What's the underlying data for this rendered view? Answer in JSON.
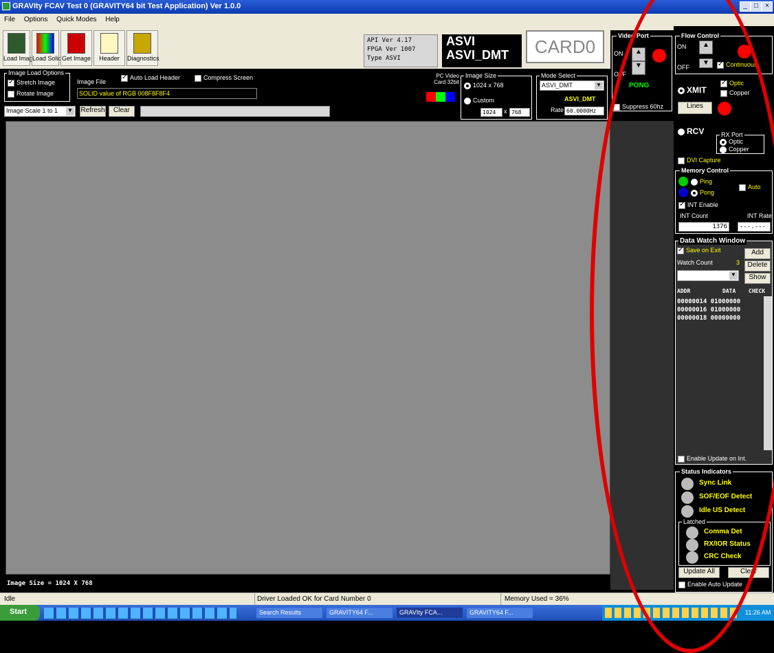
{
  "window": {
    "title": "GRAVIty FCAV Test 0 (GRAVITY64 bit Test Application) Ver 1.0.0"
  },
  "menu": [
    "File",
    "Options",
    "Quick Modes",
    "Help"
  ],
  "toolbar": {
    "buttons": [
      {
        "label": "Load Image",
        "icon": "image-icon"
      },
      {
        "label": "Load Solid",
        "icon": "rgb-icon"
      },
      {
        "label": "Get Image",
        "icon": "get-image-icon"
      },
      {
        "label": "Header",
        "icon": "header-icon"
      },
      {
        "label": "Diagnostics",
        "icon": "diagnostics-icon"
      }
    ]
  },
  "version_info": {
    "api": "API Ver  4.17",
    "fpga": "FPGA Ver  1007",
    "type": "Type  ASVI"
  },
  "mode_display": {
    "line1": "ASVI",
    "line2": "ASVI_DMT"
  },
  "card": "CARD0",
  "image_load": {
    "group_title": "Image Load Options",
    "stretch": "Stretch Image",
    "rotate": "Rotate Image",
    "file_label": "Image File",
    "auto_load_header": "Auto Load Header",
    "compress_screen": "Compress Screen",
    "file_value": "SOLID value of RGB 008F8F8F4",
    "scale": "Image Scale 1 to 1",
    "refresh": "Refresh",
    "clear": "Clear"
  },
  "pc_video": {
    "line1": "PC Video",
    "line2": "Card 32bit"
  },
  "image_size": {
    "title": "Image Size",
    "opt1": "1024 x 768",
    "opt2": "Custom",
    "w": "1024",
    "x": "x",
    "h": "768"
  },
  "mode_select": {
    "title": "Mode Select",
    "value": "ASVI_DMT",
    "name": "ASVI_DMT",
    "rate_label": "Rate",
    "rate": "60.0000Hz"
  },
  "video_port": {
    "title": "Video Port",
    "on": "ON",
    "off": "OFF",
    "state": "PONG",
    "suppress": "Suppress 60hz"
  },
  "flow_control": {
    "title": "Flow Control",
    "on": "ON",
    "off": "OFF",
    "continuous": "Continuous"
  },
  "xmit": {
    "label": "XMIT",
    "optic": "Optic",
    "copper": "Copper",
    "lines": "Lines"
  },
  "rcv": {
    "label": "RCV",
    "port_title": "RX Port",
    "optic": "Optic",
    "copper": "Copper",
    "dvi": "DVI Capture"
  },
  "memory": {
    "title": "Memory Control",
    "ping": "Ping",
    "pong": "Pong",
    "auto": "Auto",
    "int_enable": "INT Enable",
    "int_count_label": "INT Count",
    "int_rate_label": "INT Rate",
    "int_count": "1376",
    "int_rate": "---.---"
  },
  "watch": {
    "title": "Data Watch Window",
    "save_on_exit": "Save on Exit",
    "add": "Add",
    "watch_count": "Watch Count",
    "count": "3",
    "delete": "Delete",
    "show": "Show",
    "col_addr": "ADDR",
    "col_data": "DATA",
    "col_chk": "CHECK",
    "rows": [
      "00000014  01000000",
      "00000016  01000000",
      "00000018  00000000"
    ],
    "enable_update": "Enable Update on Int."
  },
  "status": {
    "title": "Status Indicators",
    "sync": "Sync Link",
    "sof": "SOF/EOF Detect",
    "idle": "Idle US Detect",
    "latched": "Latched",
    "comma": "Comma Det",
    "rx": "RX/IOR Status",
    "crc": "CRC Check",
    "update_all": "Update All",
    "clear": "Clear",
    "auto_update": "Enable Auto Update"
  },
  "image_size_readout": "Image Size = 1024 X 768",
  "statusbar": {
    "left": "Idle",
    "middle": "Driver Loaded OK for Card Number 0",
    "right": "Memory Used = 36%"
  },
  "taskbar": {
    "start": "Start",
    "tasks": [
      "Search Results",
      "GRAVITY64 F...",
      "GRAVIty FCA...",
      "GRAVITY64 F..."
    ],
    "clock": "11:26 AM"
  }
}
